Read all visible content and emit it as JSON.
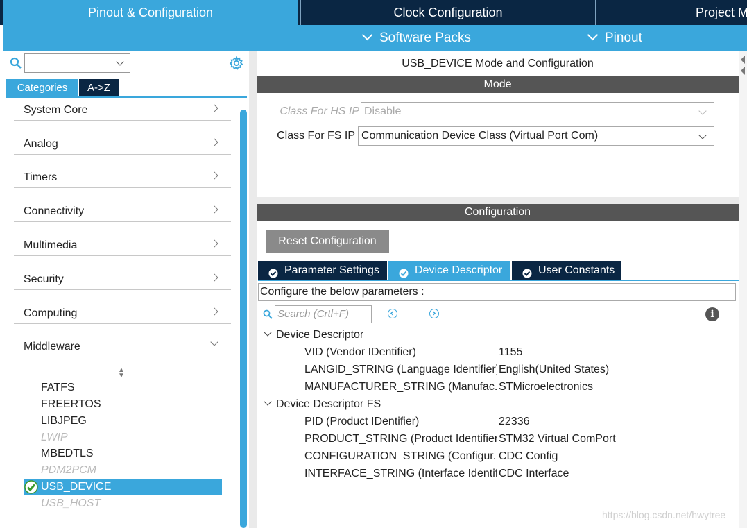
{
  "top_tabs": {
    "pinout_config": "Pinout & Configuration",
    "clock_config": "Clock Configuration",
    "project": "Project Manager"
  },
  "sub_bar": {
    "software_packs": "Software Packs",
    "pinout": "Pinout"
  },
  "left": {
    "search_value": "",
    "tabs": {
      "categories": "Categories",
      "az": "A->Z"
    },
    "categories": [
      {
        "label": "System Core"
      },
      {
        "label": "Analog"
      },
      {
        "label": "Timers"
      },
      {
        "label": "Connectivity"
      },
      {
        "label": "Multimedia"
      },
      {
        "label": "Security"
      },
      {
        "label": "Computing"
      },
      {
        "label": "Middleware",
        "expanded": true
      }
    ],
    "middleware_items": [
      {
        "label": "FATFS",
        "enabled": true
      },
      {
        "label": "FREERTOS",
        "enabled": true
      },
      {
        "label": "LIBJPEG",
        "enabled": true
      },
      {
        "label": "LWIP",
        "enabled": false
      },
      {
        "label": "MBEDTLS",
        "enabled": true
      },
      {
        "label": "PDM2PCM",
        "enabled": false
      },
      {
        "label": "USB_DEVICE",
        "enabled": true,
        "selected": true,
        "checked": true
      },
      {
        "label": "USB_HOST",
        "enabled": false
      }
    ]
  },
  "mode": {
    "title": "USB_DEVICE Mode and Configuration",
    "section_label": "Mode",
    "hs_label": "Class For HS IP",
    "hs_value": "Disable",
    "fs_label": "Class For FS IP",
    "fs_value": "Communication Device Class (Virtual Port Com)"
  },
  "config": {
    "section_label": "Configuration",
    "reset_label": "Reset Configuration",
    "tabs": {
      "params": "Parameter Settings",
      "descriptor": "Device Descriptor",
      "constants": "User Constants"
    },
    "configure_text": "Configure the below parameters :",
    "search_placeholder": "Search (Crtl+F)",
    "groups": [
      {
        "name": "Device Descriptor",
        "params": [
          {
            "name": "VID (Vendor IDentifier)",
            "value": "1155"
          },
          {
            "name": "LANGID_STRING (Language Identifier)",
            "value": "English(United States)"
          },
          {
            "name": "MANUFACTURER_STRING (Manufac...",
            "value": "STMicroelectronics"
          }
        ]
      },
      {
        "name": "Device Descriptor FS",
        "params": [
          {
            "name": "PID (Product IDentifier)",
            "value": "22336"
          },
          {
            "name": "PRODUCT_STRING (Product Identifier)",
            "value": "STM32 Virtual ComPort"
          },
          {
            "name": "CONFIGURATION_STRING (Configur...",
            "value": "CDC Config"
          },
          {
            "name": "INTERFACE_STRING (Interface Identifi...",
            "value": "CDC Interface"
          }
        ]
      }
    ]
  },
  "watermark": "https://blog.csdn.net/hwytree",
  "colors": {
    "accent": "#3aa7dc",
    "dark_navy": "#0a2643",
    "section_gray": "#555555"
  }
}
